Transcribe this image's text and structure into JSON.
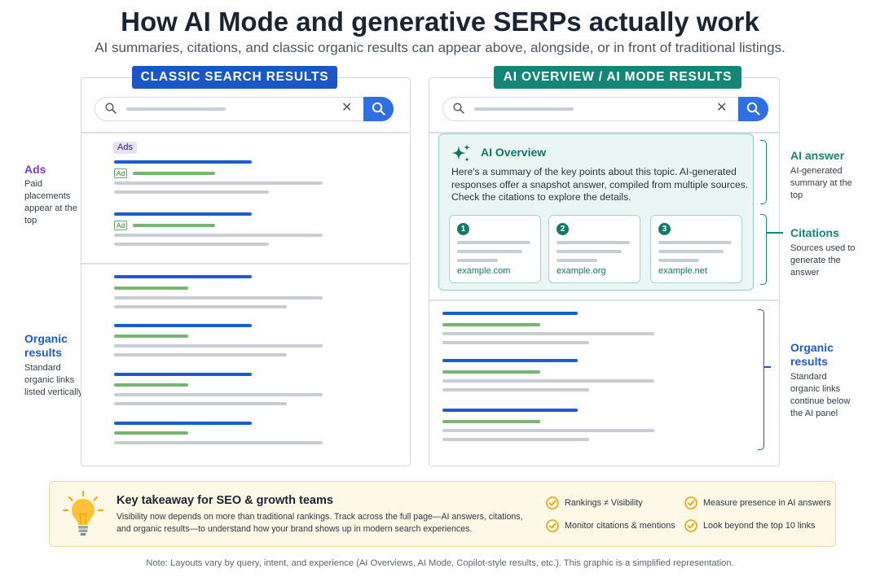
{
  "header": {
    "title": "How AI Mode and generative SERPs actually work",
    "subtitle": "AI summaries, citations, and classic organic results can appear above, alongside, or in front of traditional listings."
  },
  "classic_panel": {
    "label": "CLASSIC SEARCH RESULTS",
    "ads_tag": "Ads",
    "ad_chip": "Ad",
    "clear_glyph": "✕"
  },
  "ai_panel": {
    "label": "AI OVERVIEW / AI MODE RESULTS",
    "overview_title": "AI Overview",
    "overview_text": "Here's a summary of the key points about this topic. AI-generated responses offer a snapshot answer, compiled from multiple sources. Check the citations to explore the details.",
    "citations": [
      {
        "num": "1",
        "url": "example.com"
      },
      {
        "num": "2",
        "url": "example.org"
      },
      {
        "num": "3",
        "url": "example.net"
      }
    ],
    "clear_glyph": "✕"
  },
  "left_annotations": {
    "ads": {
      "title": "Ads",
      "desc": "Paid placements appear at the top"
    },
    "organic": {
      "title": "Organic results",
      "desc": "Standard organic links listed vertically"
    }
  },
  "right_annotations": {
    "ai_answer": {
      "title": "AI answer",
      "desc": "AI-generated summary at the top"
    },
    "citations": {
      "title": "Citations",
      "desc": "Sources used to generate the answer"
    },
    "organic": {
      "title": "Organic results",
      "desc": "Standard organic links continue below the AI panel"
    }
  },
  "footer": {
    "title": "Key takeaway for SEO & growth teams",
    "text": "Visibility now depends on more than traditional rankings. Track across the full page—AI answers, citations, and organic results—to understand how your brand shows up in modern search experiences.",
    "checks": [
      "Rankings ≠ Visibility",
      "Measure presence in AI answers",
      "Monitor citations & mentions",
      "Look beyond the top 10 links"
    ]
  },
  "note": "Note: Layouts vary by query, intent, and experience (AI Overviews, AI Mode, Copilot-style results, etc.). This graphic is a simplified representation.",
  "colors": {
    "classic_accent": "#1a56c4",
    "ai_accent": "#148577",
    "ads_accent": "#7b3fc4",
    "organic_accent": "#1d5bd3"
  },
  "icons": [
    "search-icon",
    "close-icon",
    "sparkle-icon",
    "lightbulb-icon",
    "check-icon"
  ]
}
